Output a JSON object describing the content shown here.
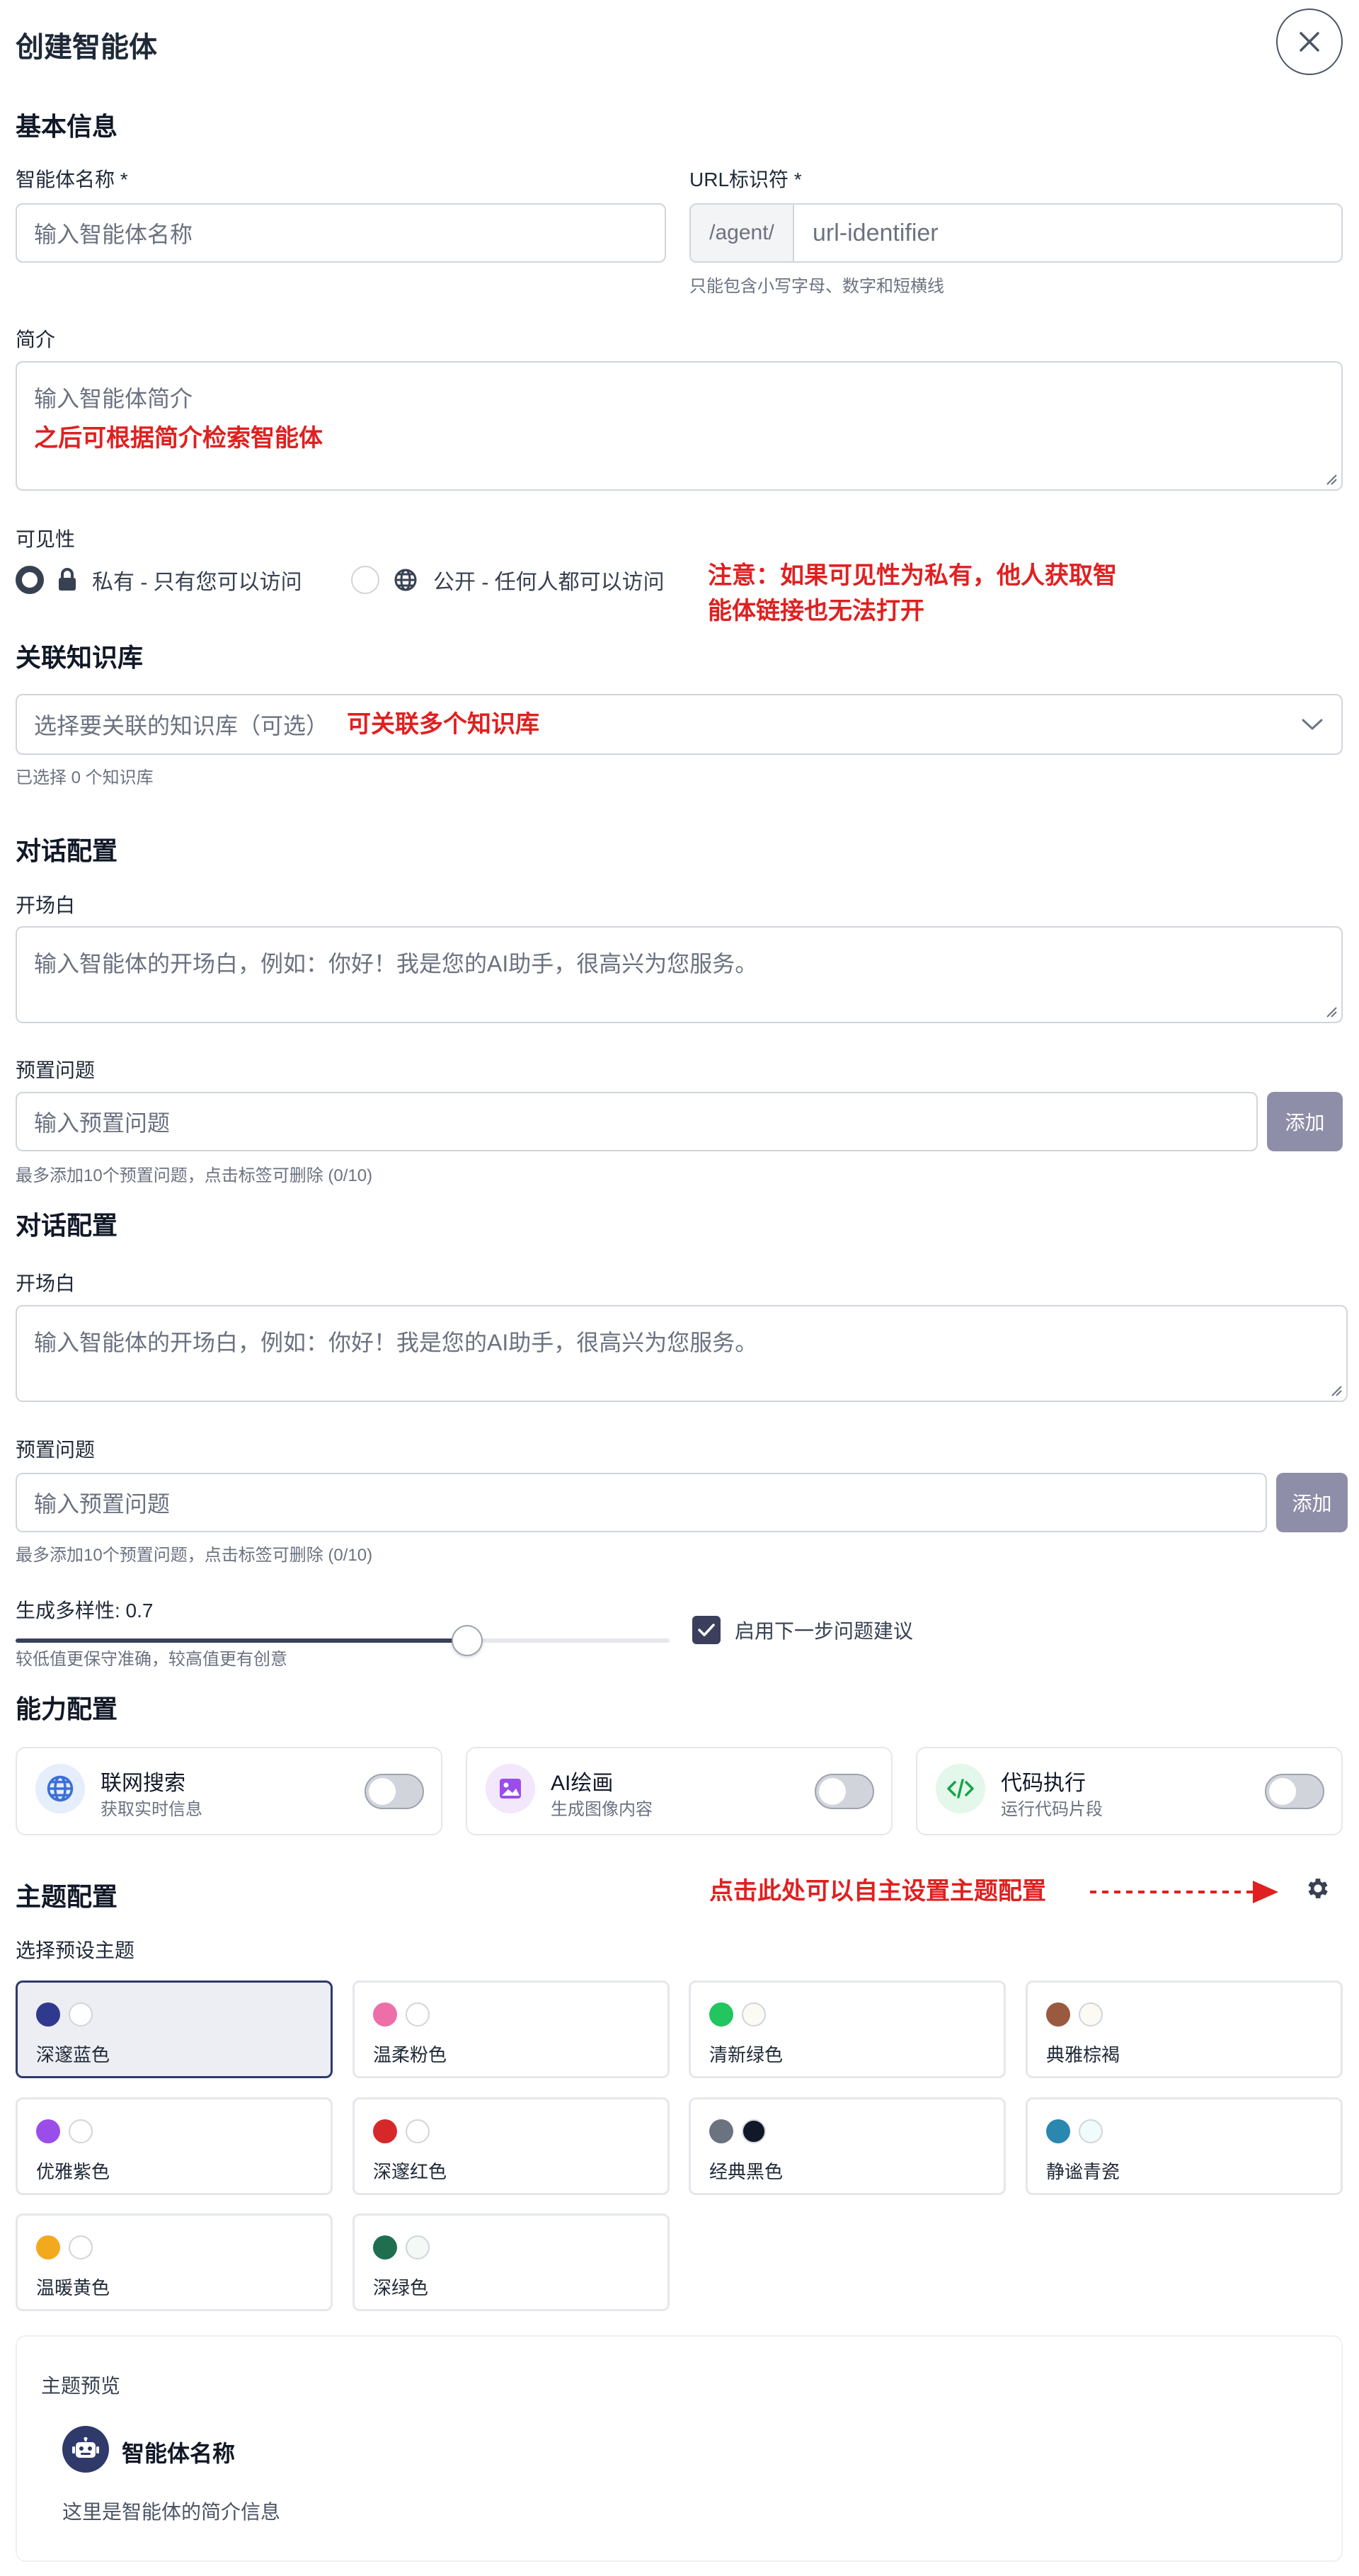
{
  "header": {
    "title": "创建智能体"
  },
  "basic": {
    "section_title": "基本信息",
    "name_label": "智能体名称 *",
    "name_placeholder": "输入智能体名称",
    "url_label": "URL标识符 *",
    "url_prefix": "/agent/",
    "url_placeholder": "url-identifier",
    "url_hint": "只能包含小写字母、数字和短横线",
    "intro_label": "简介",
    "intro_placeholder": "输入智能体简介",
    "intro_note": "之后可根据简介检索智能体",
    "visibility_label": "可见性",
    "private_label": "私有 - 只有您可以访问",
    "public_label": "公开 - 任何人都可以访问",
    "visibility_note_1": "注意：如果可见性为私有，他人获取智",
    "visibility_note_2": "能体链接也无法打开"
  },
  "knowledge": {
    "section_title": "关联知识库",
    "select_placeholder": "选择要关联的知识库（可选）",
    "select_note": "可关联多个知识库",
    "selected_count": "已选择 0 个知识库"
  },
  "dialog1": {
    "section_title": "对话配置",
    "opening_label": "开场白",
    "opening_placeholder": "输入智能体的开场白，例如：你好！我是您的AI助手，很高兴为您服务。",
    "preset_label": "预置问题",
    "preset_placeholder": "输入预置问题",
    "add_label": "添加",
    "preset_hint": "最多添加10个预置问题，点击标签可删除 (0/10)"
  },
  "dialog2": {
    "section_title": "对话配置",
    "opening_label": "开场白",
    "opening_placeholder": "输入智能体的开场白，例如：你好！我是您的AI助手，很高兴为您服务。",
    "preset_label": "预置问题",
    "preset_placeholder": "输入预置问题",
    "add_label": "添加",
    "preset_hint": "最多添加10个预置问题，点击标签可删除 (0/10)",
    "diversity_label": "生成多样性: 0.7",
    "diversity_value": 0.7,
    "diversity_hint": "较低值更保守准确，较高值更有创意",
    "suggest_label": "启用下一步问题建议"
  },
  "capabilities": {
    "section_title": "能力配置",
    "items": [
      {
        "title": "联网搜索",
        "subtitle": "获取实时信息",
        "icon": "globe-icon",
        "enabled": false
      },
      {
        "title": "AI绘画",
        "subtitle": "生成图像内容",
        "icon": "image-icon",
        "enabled": false
      },
      {
        "title": "代码执行",
        "subtitle": "运行代码片段",
        "icon": "code-icon",
        "enabled": false
      }
    ]
  },
  "theme": {
    "section_title": "主题配置",
    "settings_note": "点击此处可以自主设置主题配置",
    "preset_label": "选择预设主题",
    "presets": [
      {
        "name": "深邃蓝色",
        "primary": "#2f3a8f",
        "secondary": "#ffffff"
      },
      {
        "name": "温柔粉色",
        "primary": "#ec6fa8",
        "secondary": "#ffffff"
      },
      {
        "name": "清新绿色",
        "primary": "#22c55e",
        "secondary": "#fbfbf3"
      },
      {
        "name": "典雅棕褐",
        "primary": "#9a5a40",
        "secondary": "#fbfbf3"
      },
      {
        "name": "优雅紫色",
        "primary": "#9b4dea",
        "secondary": "#ffffff"
      },
      {
        "name": "深邃红色",
        "primary": "#d62828",
        "secondary": "#ffffff"
      },
      {
        "name": "经典黑色",
        "primary": "#6b7280",
        "secondary": "#111827"
      },
      {
        "name": "静谧青瓷",
        "primary": "#2a88b0",
        "secondary": "#f0fbfb"
      },
      {
        "name": "温暖黄色",
        "primary": "#f2a91d",
        "secondary": "#ffffff"
      },
      {
        "name": "深绿色",
        "primary": "#1f6e4f",
        "secondary": "#f3f9f5"
      }
    ],
    "preview_label": "主题预览",
    "preview_name": "智能体名称",
    "preview_desc": "这里是智能体的简介信息"
  }
}
